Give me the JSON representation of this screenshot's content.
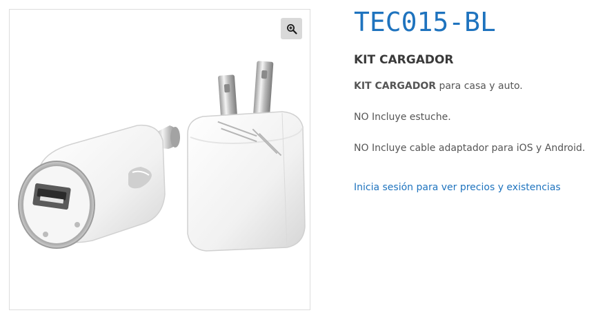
{
  "gallery": {
    "image_alt": "KIT CARGADOR",
    "zoom_icon": "magnifier-plus-icon"
  },
  "product": {
    "title": "TEC015-BL",
    "subtitle": "KIT CARGADOR",
    "desc_bold": "KIT CARGADOR",
    "desc_rest": " para casa y auto.",
    "line2": "NO Incluye estuche.",
    "line3": "NO Incluye cable adaptador para iOS y Android.",
    "login_link": "Inicia sesión para ver precios y existencias"
  },
  "colors": {
    "accent": "#1e73be",
    "text": "#555555",
    "heading": "#3a3a3a"
  }
}
